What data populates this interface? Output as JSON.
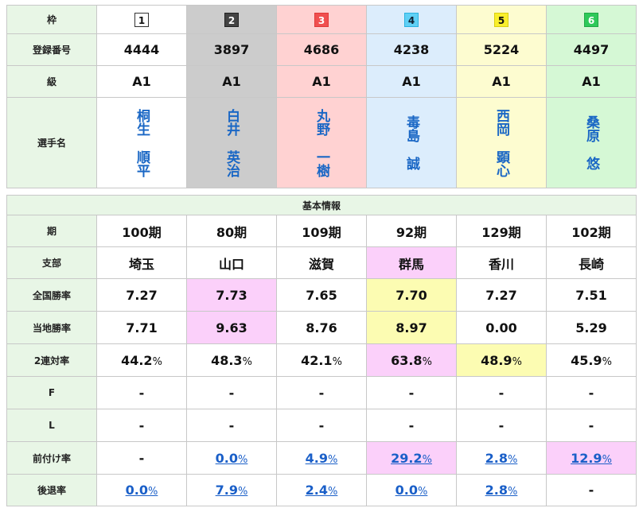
{
  "header": {
    "waku_label": "枠",
    "regno_label": "登録番号",
    "class_label": "級",
    "name_label": "選手名"
  },
  "section_title": "基本情報",
  "rows_labels": {
    "period": "期",
    "branch": "支部",
    "national_win": "全国勝率",
    "local_win": "当地勝率",
    "two_rate": "2連対率",
    "f": "F",
    "l": "L",
    "maetsuke": "前付け率",
    "koutai": "後退率"
  },
  "colors": {
    "c1": "#ffffff",
    "c2": "#cccccc",
    "c3": "#ffd2d2",
    "c4": "#dcedfc",
    "c5": "#fdfcd0",
    "c6": "#d5f8d5",
    "highlight_pink": "#fbd0fa",
    "highlight_yellow": "#fcfcb2",
    "link": "#1a5fc8"
  },
  "pct_sign": "%",
  "racers": [
    {
      "waku": "1",
      "regno": "4444",
      "class": "A1",
      "name1": "桐生",
      "name2": "順平",
      "period": "100期",
      "branch": "埼玉",
      "national_win": "7.27",
      "local_win": "7.71",
      "two_rate": "44.2",
      "f": "-",
      "l": "-",
      "maetsuke": "-",
      "koutai": "0.0"
    },
    {
      "waku": "2",
      "regno": "3897",
      "class": "A1",
      "name1": "白井",
      "name2": "英治",
      "period": "80期",
      "branch": "山口",
      "national_win": "7.73",
      "local_win": "9.63",
      "two_rate": "48.3",
      "f": "-",
      "l": "-",
      "maetsuke": "0.0",
      "koutai": "7.9"
    },
    {
      "waku": "3",
      "regno": "4686",
      "class": "A1",
      "name1": "丸野",
      "name2": "一樹",
      "period": "109期",
      "branch": "滋賀",
      "national_win": "7.65",
      "local_win": "8.76",
      "two_rate": "42.1",
      "f": "-",
      "l": "-",
      "maetsuke": "4.9",
      "koutai": "2.4"
    },
    {
      "waku": "4",
      "regno": "4238",
      "class": "A1",
      "name1": "毒島",
      "name2": "誠",
      "period": "92期",
      "branch": "群馬",
      "national_win": "7.70",
      "local_win": "8.97",
      "two_rate": "63.8",
      "f": "-",
      "l": "-",
      "maetsuke": "29.2",
      "koutai": "0.0"
    },
    {
      "waku": "5",
      "regno": "5224",
      "class": "A1",
      "name1": "西岡",
      "name2": "顕心",
      "period": "129期",
      "branch": "香川",
      "national_win": "7.27",
      "local_win": "0.00",
      "two_rate": "48.9",
      "f": "-",
      "l": "-",
      "maetsuke": "2.8",
      "koutai": "2.8"
    },
    {
      "waku": "6",
      "regno": "4497",
      "class": "A1",
      "name1": "桑原",
      "name2": "悠",
      "period": "102期",
      "branch": "長崎",
      "national_win": "7.51",
      "local_win": "5.29",
      "two_rate": "45.9",
      "f": "-",
      "l": "-",
      "maetsuke": "12.9",
      "koutai": "-"
    }
  ]
}
